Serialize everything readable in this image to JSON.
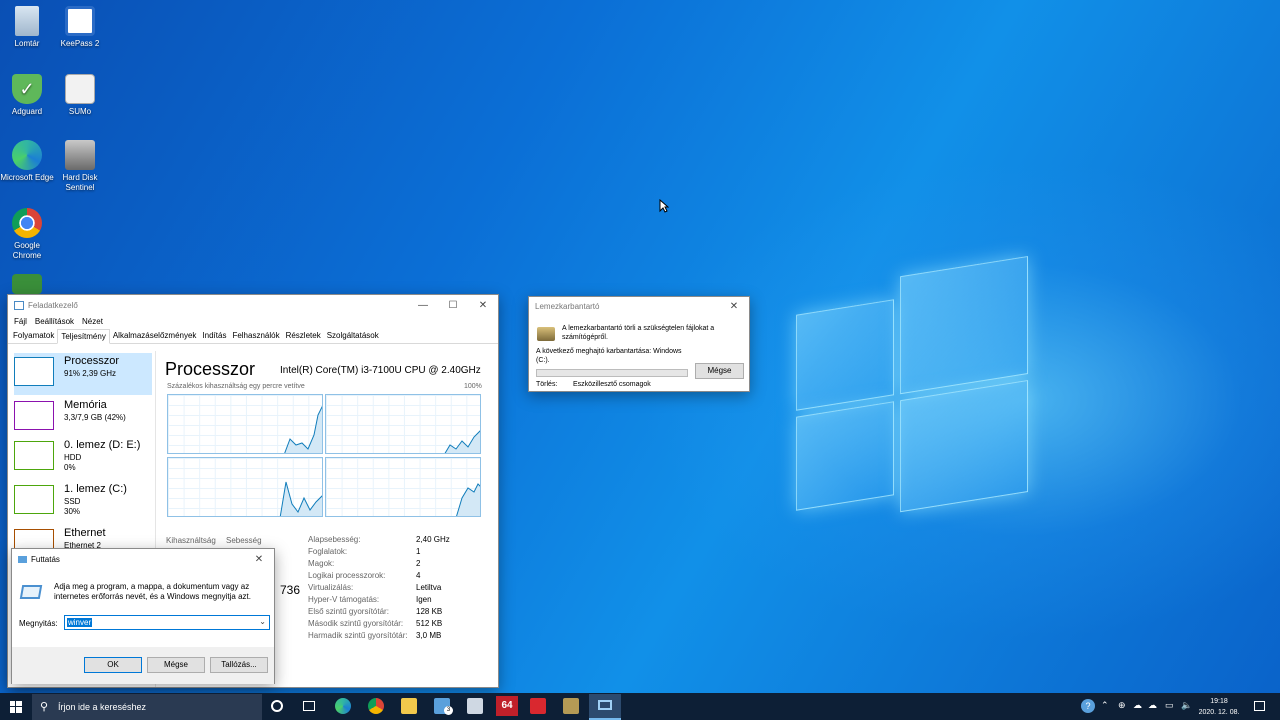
{
  "desktop": {
    "icons": [
      {
        "label": "Lomtár",
        "icon": "recycle-bin-icon"
      },
      {
        "label": "KeePass 2",
        "icon": "keepass-icon"
      },
      {
        "label": "Adguard",
        "icon": "adguard-icon"
      },
      {
        "label": "SUMo",
        "icon": "sumo-icon"
      },
      {
        "label": "Microsoft Edge",
        "icon": "edge-icon"
      },
      {
        "label": "Hard Disk Sentinel",
        "icon": "hdsentinel-icon"
      },
      {
        "label": "Google Chrome",
        "icon": "chrome-icon"
      }
    ]
  },
  "task_manager": {
    "title": "Feladatkezelő",
    "menu": [
      "Fájl",
      "Beállítások",
      "Nézet"
    ],
    "tabs": [
      "Folyamatok",
      "Teljesítmény",
      "Alkalmazáselőzmények",
      "Indítás",
      "Felhasználók",
      "Részletek",
      "Szolgáltatások"
    ],
    "active_tab": "Teljesítmény",
    "sidebar": [
      {
        "title": "Processzor",
        "line2": "91% 2,39 GHz",
        "line3": "",
        "color": "#117dbb"
      },
      {
        "title": "Memória",
        "line2": "3,3/7,9 GB (42%)",
        "line3": "",
        "color": "#8b12ae"
      },
      {
        "title": "0. lemez (D: E:)",
        "line2": "HDD",
        "line3": "0%",
        "color": "#4da60c"
      },
      {
        "title": "1. lemez (C:)",
        "line2": "SSD",
        "line3": "30%",
        "color": "#4da60c"
      },
      {
        "title": "Ethernet",
        "line2": "Ethernet 2",
        "line3": "",
        "color": "#a74f01"
      }
    ],
    "main": {
      "heading": "Processzor",
      "cpu_name": "Intel(R) Core(TM) i3-7100U CPU @ 2.40GHz",
      "graph_caption": "Százalékos kihasználtság egy percre vetítve",
      "graph_max": "100%",
      "usage_label": "Kihasználtság",
      "speed_label": "Sebesség",
      "partial_value": "736",
      "specs": [
        {
          "label": "Alapsebesség:",
          "value": "2,40 GHz"
        },
        {
          "label": "Foglalatok:",
          "value": "1"
        },
        {
          "label": "Magok:",
          "value": "2"
        },
        {
          "label": "Logikai processzorok:",
          "value": "4"
        },
        {
          "label": "Virtualizálás:",
          "value": "Letiltva"
        },
        {
          "label": "Hyper-V támogatás:",
          "value": "Igen"
        },
        {
          "label": "Első szintű gyorsítótár:",
          "value": "128 KB"
        },
        {
          "label": "Második szintű gyorsítótár:",
          "value": "512 KB"
        },
        {
          "label": "Harmadik szintű gyorsítótár:",
          "value": "3,0 MB"
        }
      ]
    }
  },
  "disk_cleanup": {
    "title": "Lemezkarbantartó",
    "description": "A lemezkarbantartó törli a szükségtelen fájlokat a számítógépről.",
    "target": "A következő meghajtó karbantartása: Windows (C:).",
    "cancel": "Mégse",
    "progress": 0.0,
    "status_label": "Törlés:",
    "status_value": "Eszközillesztő csomagok"
  },
  "run_dialog": {
    "title": "Futtatás",
    "description": "Adja meg a program, a mappa, a dokumentum vagy az internetes erőforrás nevét, és a Windows megnyitja azt.",
    "open_label": "Megnyitás:",
    "input_value": "winver",
    "ok": "OK",
    "cancel": "Mégse",
    "browse": "Tallózás..."
  },
  "taskbar": {
    "search_placeholder": "Írjon ide a kereséshez",
    "time": "19:18",
    "date": "2020. 12. 08.",
    "badge_count": "3",
    "app_64": "64"
  }
}
